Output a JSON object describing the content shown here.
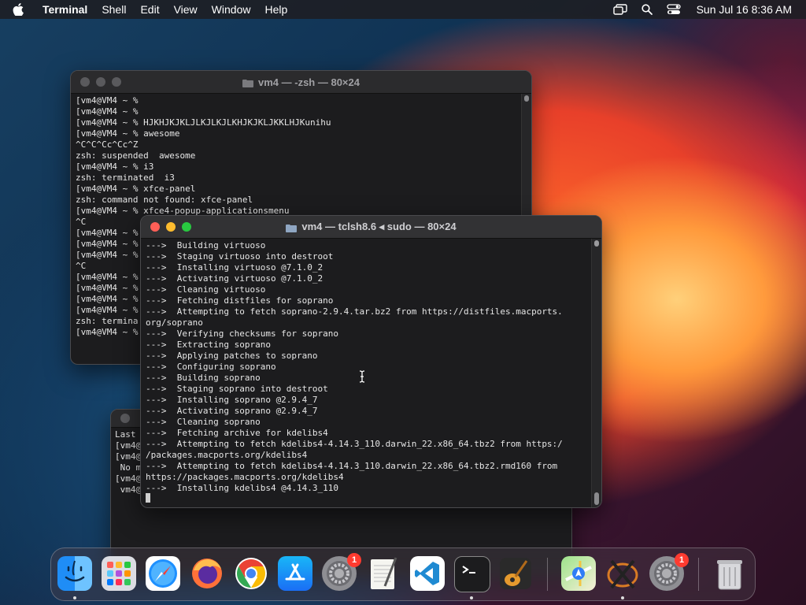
{
  "menubar": {
    "app_name": "Terminal",
    "items": [
      "Shell",
      "Edit",
      "View",
      "Window",
      "Help"
    ],
    "clock": "Sun Jul 16  8:36 AM"
  },
  "window_back": {
    "title": "vm4 — -zsh — 80×24",
    "lines": [
      "[vm4@VM4 ~ %",
      "[vm4@VM4 ~ %",
      "[vm4@VM4 ~ % HJKHJKJKLJLKJLKJLKHJKJKLJKKLHJKunihu",
      "[vm4@VM4 ~ % awesome",
      "^C^C^Cc^Cc^Z",
      "zsh: suspended  awesome",
      "[vm4@VM4 ~ % i3",
      "zsh: terminated  i3",
      "[vm4@VM4 ~ % xfce-panel",
      "zsh: command not found: xfce-panel",
      "[vm4@VM4 ~ % xfce4-popup-applicationsmenu",
      "^C",
      "[vm4@VM4 ~ %",
      "[vm4@VM4 ~ %",
      "[vm4@VM4 ~ %",
      "^C",
      "[vm4@VM4 ~ %",
      "[vm4@VM4 ~ %",
      "[vm4@VM4 ~ %",
      "[vm4@VM4 ~ %",
      "zsh: termina",
      "[vm4@VM4 ~ %"
    ]
  },
  "window_third": {
    "lines": [
      "Last",
      "[vm4@V",
      "[vm4@V",
      " No ma",
      "[vm4@V",
      " vm4@V"
    ]
  },
  "window_front": {
    "title": "vm4 — tclsh8.6 ◂ sudo — 80×24",
    "lines": [
      "--->  Building virtuoso",
      "--->  Staging virtuoso into destroot",
      "--->  Installing virtuoso @7.1.0_2",
      "--->  Activating virtuoso @7.1.0_2",
      "--->  Cleaning virtuoso",
      "--->  Fetching distfiles for soprano",
      "--->  Attempting to fetch soprano-2.9.4.tar.bz2 from https://distfiles.macports.",
      "org/soprano",
      "--->  Verifying checksums for soprano",
      "--->  Extracting soprano",
      "--->  Applying patches to soprano",
      "--->  Configuring soprano",
      "--->  Building soprano",
      "--->  Staging soprano into destroot",
      "--->  Installing soprano @2.9.4_7",
      "--->  Activating soprano @2.9.4_7",
      "--->  Cleaning soprano",
      "--->  Fetching archive for kdelibs4",
      "--->  Attempting to fetch kdelibs4-4.14.3_110.darwin_22.x86_64.tbz2 from https:/",
      "/packages.macports.org/kdelibs4",
      "--->  Attempting to fetch kdelibs4-4.14.3_110.darwin_22.x86_64.tbz2.rmd160 from",
      "https://packages.macports.org/kdelibs4",
      "--->  Installing kdelibs4 @4.14.3_110"
    ]
  },
  "dock": {
    "badges": {
      "system_settings_1": "1",
      "system_settings_2": "1"
    }
  },
  "colors": {
    "accent_red": "#ff5f57",
    "accent_yellow": "#febc2e",
    "accent_green": "#28c840",
    "terminal_bg": "#1c1c1e",
    "terminal_text": "#e6e6e6"
  }
}
